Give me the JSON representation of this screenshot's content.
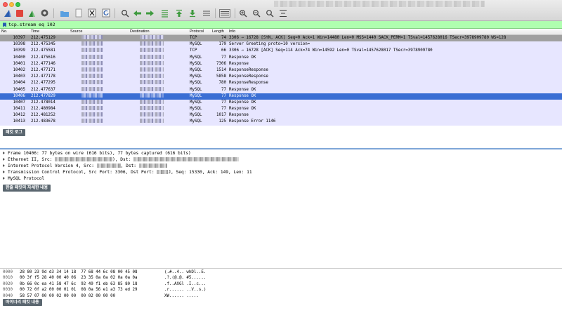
{
  "filter": {
    "value": "tcp.stream eq 102"
  },
  "columns": {
    "no": "No.",
    "time": "Time",
    "source": "Source",
    "destination": "Destination",
    "protocol": "Protocol",
    "length": "Length",
    "info": "Info"
  },
  "packets": [
    {
      "no": "10397",
      "time": "212.475129",
      "protocol": "TCP",
      "length": "74",
      "info": "3306 → 16728 [SYN, ACK] Seq=0 Ack=1 Win=14480 Len=0 MSS=1440 SACK_PERM=1 TSval=1457628016 TSecr=3978909780 WS=128",
      "style": "tcp-grey"
    },
    {
      "no": "10398",
      "time": "212.475345",
      "protocol": "MySQL",
      "length": "179",
      "info": "Server Greeting proto=10 version=",
      "style": "normal"
    },
    {
      "no": "10399",
      "time": "212.475581",
      "protocol": "TCP",
      "length": "66",
      "info": "3306 → 16728 [ACK] Seq=114 Ack=74 Win=14592 Len=0 TSval=1457628017 TSecr=3978909780",
      "style": "normal"
    },
    {
      "no": "10400",
      "time": "212.475616",
      "protocol": "MySQL",
      "length": "77",
      "info": "Response OK",
      "style": "normal"
    },
    {
      "no": "10401",
      "time": "212.477146",
      "protocol": "MySQL",
      "length": "7306",
      "info": "Response",
      "style": "normal"
    },
    {
      "no": "10402",
      "time": "212.477171",
      "protocol": "MySQL",
      "length": "1514",
      "info": "ResponseResponse",
      "style": "normal"
    },
    {
      "no": "10403",
      "time": "212.477178",
      "protocol": "MySQL",
      "length": "5858",
      "info": "ResponseResponse",
      "style": "normal"
    },
    {
      "no": "10404",
      "time": "212.477295",
      "protocol": "MySQL",
      "length": "780",
      "info": "ResponseResponse",
      "style": "normal"
    },
    {
      "no": "10405",
      "time": "212.477637",
      "protocol": "MySQL",
      "length": "77",
      "info": "Response OK",
      "style": "normal"
    },
    {
      "no": "10406",
      "time": "212.477829",
      "protocol": "MySQL",
      "length": "77",
      "info": "Response OK",
      "style": "sel"
    },
    {
      "no": "10407",
      "time": "212.478014",
      "protocol": "MySQL",
      "length": "77",
      "info": "Response OK",
      "style": "normal"
    },
    {
      "no": "10411",
      "time": "212.480984",
      "protocol": "MySQL",
      "length": "77",
      "info": "Response OK",
      "style": "normal"
    },
    {
      "no": "10412",
      "time": "212.481252",
      "protocol": "MySQL",
      "length": "1017",
      "info": "Response",
      "style": "normal"
    },
    {
      "no": "10413",
      "time": "212.483678",
      "protocol": "MySQL",
      "length": "125",
      "info": "Response Error 1146",
      "style": "normal"
    }
  ],
  "labels": {
    "packet_log": "패킷 로그",
    "packet_detail": "한줄 패킷의 자세한 내용",
    "binary_packet": "바이너리 패킷 내용"
  },
  "details": {
    "frame": "Frame 10406: 77 bytes on wire (616 bits), 77 bytes captured (616 bits)",
    "ethernet_a": "Ethernet II, Src: ",
    "ethernet_b": "), Dst: ",
    "ip_a": "Internet Protocol Version 4, Src: ",
    "ip_b": ", Dst: ",
    "tcp_a": "Transmission Control Protocol, Src Port: 3306, Dst Port: ",
    "tcp_b": "J, Seq: 15330, Ack: 149, Len: 11",
    "mysql": "MySQL Protocol"
  },
  "bytes": [
    {
      "off": "0000",
      "hex": "28 80 23 9d d3 34 14 18  77 68 44 6c 08 00 45 08",
      "ascii": "(.#..4.. whDl..E."
    },
    {
      "off": "0010",
      "hex": "00 3f f5 28 40 00 40 06  23 35 0a 0a 02 0a 0a 0a",
      "ascii": ".?.(@.@. #5......"
    },
    {
      "off": "0020",
      "hex": "0b 66 0c ea 41 58 47 6c  92 49 f1 eb 63 85 80 18",
      "ascii": ".f..AXGl .I..c..."
    },
    {
      "off": "0030",
      "hex": "00 72 0f a2 00 00 01 01  08 0a 56 e1 a3 73 ed 29",
      "ascii": ".r...... ..V..s.)"
    },
    {
      "off": "0040",
      "hex": "58 57 07 00 00 02 00 00  00 02 00 00 00",
      "ascii": "XW...... ....."
    }
  ],
  "colors": {
    "selected": "#3a6ed4",
    "filter_ok": "#afffaf",
    "tag": "#5b6770",
    "row_tcp": "#e7e6ff"
  }
}
